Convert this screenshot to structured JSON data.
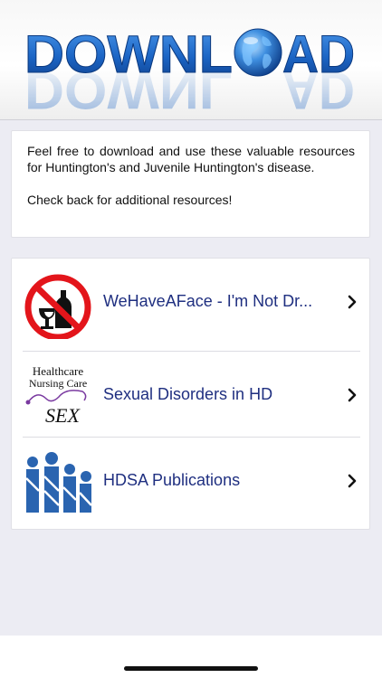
{
  "banner": {
    "title_left": "DOWNL",
    "title_right": "AD",
    "colors": {
      "letters": "#1f6fcf",
      "globe": "#2b7ad8"
    }
  },
  "intro": {
    "paragraph1": "Feel free to download and use these valuable resources for Huntington's and Juvenile Huntington's disease.",
    "paragraph2": "Check back for additional resources!"
  },
  "resources": [
    {
      "label": "WeHaveAFace - I'm Not Dr...",
      "icon": "no-drinking-icon"
    },
    {
      "label": "Sexual Disorders in HD",
      "icon": "healthcare-nursing-care-sex-logo",
      "logo_text": {
        "line1": "Healthcare",
        "line2": "Nursing Care",
        "line3": "SEX"
      }
    },
    {
      "label": "HDSA Publications",
      "icon": "hdsa-logo"
    }
  ],
  "colors": {
    "link_text": "#1f2f80",
    "background": "#ececf3",
    "card": "#ffffff"
  }
}
